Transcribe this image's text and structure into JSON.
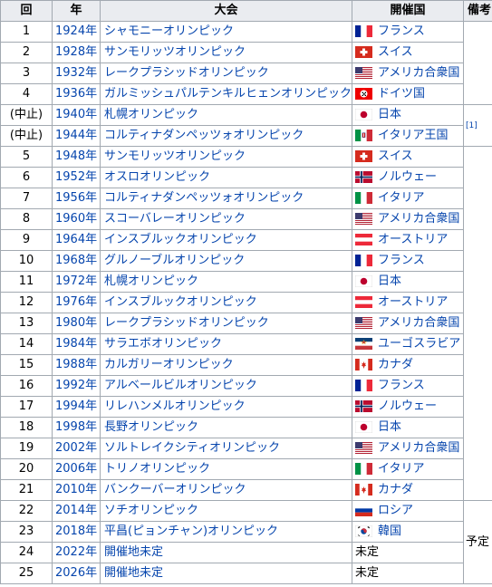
{
  "headers": {
    "no": "回",
    "year": "年",
    "event": "大会",
    "host": "開催国",
    "note": "備考"
  },
  "notes": {
    "cancelled_ref": "[1]",
    "planned": "予定"
  },
  "rows": [
    {
      "no": "1",
      "year": "1924年",
      "event": "シャモニーオリンピック",
      "host": "フランス",
      "flag": "france",
      "note_group": "none"
    },
    {
      "no": "2",
      "year": "1928年",
      "event": "サンモリッツオリンピック",
      "host": "スイス",
      "flag": "swiss",
      "note_group": "none"
    },
    {
      "no": "3",
      "year": "1932年",
      "event": "レークプラシッドオリンピック",
      "host": "アメリカ合衆国",
      "flag": "usa",
      "note_group": "none"
    },
    {
      "no": "4",
      "year": "1936年",
      "event": "ガルミッシュパルテンキルヒェンオリンピック",
      "host": "ドイツ国",
      "flag": "germany3rd",
      "note_group": "none"
    },
    {
      "no": "(中止)",
      "year": "1940年",
      "event": "札幌オリンピック",
      "host": "日本",
      "flag": "japan",
      "note_group": "cancelled"
    },
    {
      "no": "(中止)",
      "year": "1944年",
      "event": "コルティナダンペッツォオリンピック",
      "host": "イタリア王国",
      "flag": "italykingdom",
      "note_group": "cancelled"
    },
    {
      "no": "5",
      "year": "1948年",
      "event": "サンモリッツオリンピック",
      "host": "スイス",
      "flag": "swiss",
      "note_group": "none2"
    },
    {
      "no": "6",
      "year": "1952年",
      "event": "オスロオリンピック",
      "host": "ノルウェー",
      "flag": "norway",
      "note_group": "none2"
    },
    {
      "no": "7",
      "year": "1956年",
      "event": "コルティナダンペッツォオリンピック",
      "host": "イタリア",
      "flag": "italy",
      "note_group": "none2"
    },
    {
      "no": "8",
      "year": "1960年",
      "event": "スコーバレーオリンピック",
      "host": "アメリカ合衆国",
      "flag": "usa",
      "note_group": "none2"
    },
    {
      "no": "9",
      "year": "1964年",
      "event": "インスブルックオリンピック",
      "host": "オーストリア",
      "flag": "austria",
      "note_group": "none2"
    },
    {
      "no": "10",
      "year": "1968年",
      "event": "グルノーブルオリンピック",
      "host": "フランス",
      "flag": "france",
      "note_group": "none2"
    },
    {
      "no": "11",
      "year": "1972年",
      "event": "札幌オリンピック",
      "host": "日本",
      "flag": "japan",
      "note_group": "none2"
    },
    {
      "no": "12",
      "year": "1976年",
      "event": "インスブルックオリンピック",
      "host": "オーストリア",
      "flag": "austria",
      "note_group": "none2"
    },
    {
      "no": "13",
      "year": "1980年",
      "event": "レークプラシッドオリンピック",
      "host": "アメリカ合衆国",
      "flag": "usa",
      "note_group": "none2"
    },
    {
      "no": "14",
      "year": "1984年",
      "event": "サラエボオリンピック",
      "host": "ユーゴスラビア",
      "flag": "yugoslavia",
      "note_group": "none2"
    },
    {
      "no": "15",
      "year": "1988年",
      "event": "カルガリーオリンピック",
      "host": "カナダ",
      "flag": "canada",
      "note_group": "none2"
    },
    {
      "no": "16",
      "year": "1992年",
      "event": "アルベールビルオリンピック",
      "host": "フランス",
      "flag": "france",
      "note_group": "none2"
    },
    {
      "no": "17",
      "year": "1994年",
      "event": "リレハンメルオリンピック",
      "host": "ノルウェー",
      "flag": "norway",
      "note_group": "none2"
    },
    {
      "no": "18",
      "year": "1998年",
      "event": "長野オリンピック",
      "host": "日本",
      "flag": "japan",
      "note_group": "none2"
    },
    {
      "no": "19",
      "year": "2002年",
      "event": "ソルトレイクシティオリンピック",
      "host": "アメリカ合衆国",
      "flag": "usa",
      "note_group": "none2"
    },
    {
      "no": "20",
      "year": "2006年",
      "event": "トリノオリンピック",
      "host": "イタリア",
      "flag": "italy",
      "note_group": "none2"
    },
    {
      "no": "21",
      "year": "2010年",
      "event": "バンクーバーオリンピック",
      "host": "カナダ",
      "flag": "canada",
      "note_group": "none2"
    },
    {
      "no": "22",
      "year": "2014年",
      "event": "ソチオリンピック",
      "host": "ロシア",
      "flag": "russia",
      "note_group": "planned"
    },
    {
      "no": "23",
      "year": "2018年",
      "event": "平昌(ピョンチャン)オリンピック",
      "host": "韓国",
      "flag": "korea",
      "note_group": "planned"
    },
    {
      "no": "24",
      "year": "2022年",
      "event": "開催地未定",
      "host": "未定",
      "flag": "",
      "note_group": "planned"
    },
    {
      "no": "25",
      "year": "2026年",
      "event": "開催地未定",
      "host": "未定",
      "flag": "",
      "note_group": "planned"
    }
  ],
  "colors": {
    "link": "#0645ad",
    "header_bg": "#eaecf0",
    "border": "#a2a9b1"
  }
}
